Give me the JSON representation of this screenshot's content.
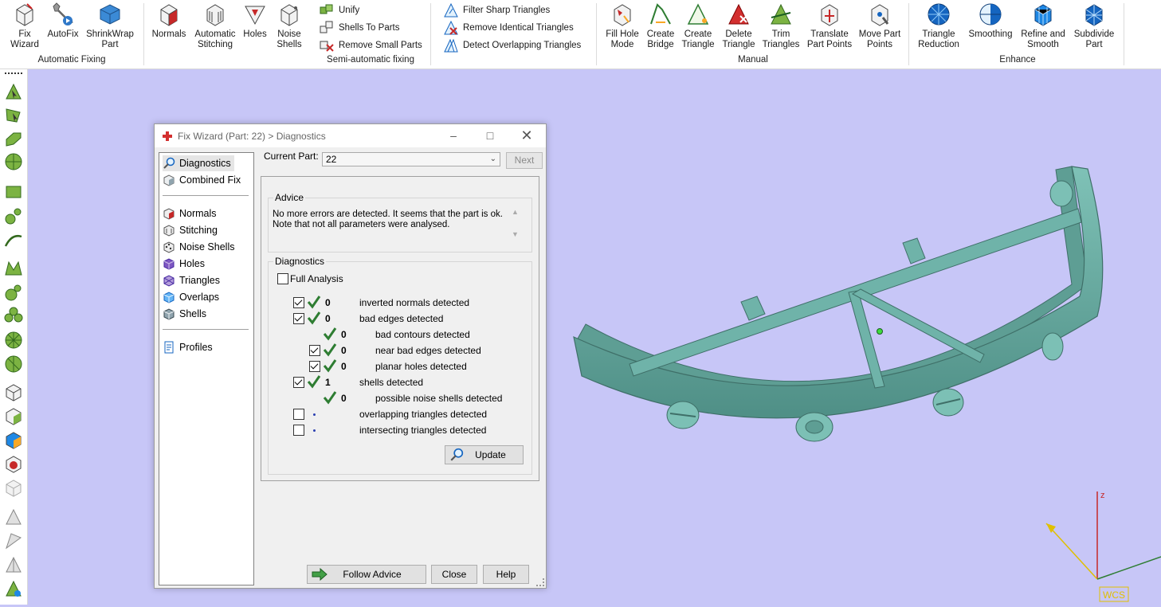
{
  "ribbon": {
    "automatic_fixing": {
      "label": "Automatic Fixing",
      "buttons": [
        "Fix\nWizard",
        "AutoFix",
        "ShrinkWrap\nPart"
      ]
    },
    "semi_automatic": {
      "label": "Semi-automatic fixing",
      "buttons": [
        "Normals",
        "Automatic\nStitching",
        "Holes",
        "Noise\nShells"
      ],
      "small": [
        "Unify",
        "Shells To Parts",
        "Remove Small Parts"
      ]
    },
    "filters": [
      "Filter Sharp Triangles",
      "Remove Identical Triangles",
      "Detect Overlapping Triangles"
    ],
    "manual": {
      "label": "Manual",
      "buttons": [
        "Fill Hole\nMode",
        "Create\nBridge",
        "Create\nTriangle",
        "Delete\nTriangle",
        "Trim\nTriangles",
        "Translate\nPart Points",
        "Move Part\nPoints"
      ]
    },
    "enhance": {
      "label": "Enhance",
      "buttons": [
        "Triangle\nReduction",
        "Smoothing",
        "Refine and\nSmooth",
        "Subdivide\nPart"
      ]
    }
  },
  "dialog": {
    "title": "Fix Wizard (Part: 22) > Diagnostics",
    "nav": {
      "top": [
        "Diagnostics",
        "Combined Fix"
      ],
      "middle": [
        "Normals",
        "Stitching",
        "Noise Shells",
        "Holes",
        "Triangles",
        "Overlaps",
        "Shells"
      ],
      "bottom": [
        "Profiles"
      ]
    },
    "current_part_label": "Current Part:",
    "current_part_value": "22",
    "next_label": "Next",
    "advice_label": "Advice",
    "advice_text": "No more errors are detected. It seems that the part is ok. Note that not all parameters were analysed.",
    "diagnostics_label": "Diagnostics",
    "full_analysis_label": "Full Analysis",
    "rows": [
      {
        "count": "0",
        "text": "inverted normals detected"
      },
      {
        "count": "0",
        "text": "bad edges detected"
      },
      {
        "count": "0",
        "text": "bad contours detected"
      },
      {
        "count": "0",
        "text": "near bad edges detected"
      },
      {
        "count": "0",
        "text": "planar holes detected"
      },
      {
        "count": "1",
        "text": "shells detected"
      },
      {
        "count": "0",
        "text": "possible noise shells detected"
      },
      {
        "count": "",
        "text": "overlapping triangles detected"
      },
      {
        "count": "",
        "text": "intersecting triangles detected"
      }
    ],
    "update_label": "Update",
    "follow_advice_label": "Follow Advice",
    "close_label": "Close",
    "help_label": "Help"
  },
  "axes": {
    "z_label": "z",
    "wcs_label": "WCS"
  },
  "colors": {
    "viewport_bg": "#c7c6f7",
    "part_color": "#6fb3a9",
    "accent_blue": "#2f78c8",
    "tick_green": "#2e7d32"
  }
}
